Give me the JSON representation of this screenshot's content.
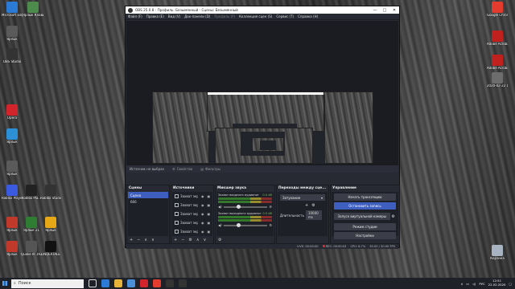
{
  "desktop_icons_left": [
    {
      "label": "Microsoft Edge",
      "color": "#2b7bd6"
    },
    {
      "label": "Ярлык Клавиатура",
      "color": "#4c8b4c"
    },
    {
      "label": "OBS Studio",
      "color": "#333333"
    },
    {
      "label": "Ярлык",
      "color": "#5a5a5a"
    },
    {
      "label": "Opera",
      "color": "#d1242b"
    },
    {
      "label": "Ярлык",
      "color": "#2d8fd5"
    },
    {
      "label": "Ярлык",
      "color": "#5a5a5a"
    },
    {
      "label": "Roblox Player",
      "color": "#3a5ae0"
    },
    {
      "label": "Roblox Pla...",
      "color": "#222222"
    },
    {
      "label": "Roblox Studio",
      "color": "#333333"
    },
    {
      "label": "Ярлык",
      "color": "#c0392b"
    },
    {
      "label": "Ярлык 21",
      "color": "#2e7d32"
    },
    {
      "label": "Ярлык",
      "color": "#e6a817"
    },
    {
      "label": "Ярлык",
      "color": "#c0392b"
    },
    {
      "label": "Quake III 1920x1080",
      "color": "#555555"
    },
    {
      "label": "UNDERTALE",
      "color": "#111111"
    }
  ],
  "desktop_icons_right": [
    {
      "label": "Google Chrome",
      "color": "#e33b2e"
    },
    {
      "label": "Adobe Acrobat Reader DC",
      "color": "#c0211f"
    },
    {
      "label": "Adobe Acrobat Reader DC",
      "color": "#c0211f"
    },
    {
      "label": "2020-02-22 14-36-07",
      "color": "#6d6d6d"
    },
    {
      "label": "Корзина",
      "color": "#a8b3c2"
    }
  ],
  "obs": {
    "title": "OBS 25.0.8 - Профиль: Безымянный - Сцены: Безымянный",
    "title_controls": [
      "—",
      "□",
      "✕"
    ],
    "menu": [
      {
        "label": "Файл (F)",
        "disabled": false
      },
      {
        "label": "Правка (E)",
        "disabled": false
      },
      {
        "label": "Вид (V)",
        "disabled": false
      },
      {
        "label": "Док-панели (D)",
        "disabled": false
      },
      {
        "label": "Профиль (P)",
        "disabled": true
      },
      {
        "label": "Коллекция сцен (S)",
        "disabled": false
      },
      {
        "label": "Сервис (T)",
        "disabled": false
      },
      {
        "label": "Справка (H)",
        "disabled": false
      }
    ],
    "preview_bar": {
      "source_status": "Источник не выбран",
      "properties_label": "Свойства",
      "filters_label": "Фильтры"
    },
    "scenes": {
      "title": "Сцены",
      "items": [
        "Сцена",
        "666"
      ],
      "active_index": 0,
      "footer": [
        "+",
        "−",
        "∧",
        "∨"
      ]
    },
    "sources": {
      "title": "Источники",
      "items": [
        "Захват экр",
        "Захват экр",
        "Захват экр",
        "Захват экр",
        "Захват экр"
      ],
      "footer": [
        "+",
        "−",
        "⚙",
        "∧",
        "∨"
      ]
    },
    "mixer": {
      "title": "Микшер звука",
      "tracks": [
        {
          "name": "Захват входного аудиопот",
          "db": "0.0 dB"
        },
        {
          "name": "Захват выходного аудиопот",
          "db": "0.0 dB"
        }
      ]
    },
    "transitions": {
      "title": "Переходы между сце...",
      "selected": "Затухание",
      "duration_label": "Длительность",
      "duration_value": "10000 ms"
    },
    "controls": {
      "title": "Управление",
      "buttons": [
        {
          "label": "Начать трансляцию",
          "primary": false
        },
        {
          "label": "Остановить запись",
          "primary": true
        },
        {
          "label": "Запуск виртуальной камеры",
          "primary": false
        },
        {
          "label": "Режим студии",
          "primary": false
        },
        {
          "label": "Настройки",
          "primary": false
        }
      ]
    },
    "statusbar": {
      "live": "LIVE: 00:00:00",
      "rec": "REC: 00:00:03",
      "cpu": "CPU: 6.7%",
      "fps": "30.00 / 30.00 FPS"
    }
  },
  "taskbar": {
    "search_placeholder": "Поиск",
    "apps": [
      {
        "name": "task-view-icon",
        "color": "#dddddd"
      },
      {
        "name": "edge-icon",
        "color": "#2b7bd6"
      },
      {
        "name": "explorer-icon",
        "color": "#e8b33a"
      },
      {
        "name": "store-icon",
        "color": "#4a90d9"
      },
      {
        "name": "opera-icon",
        "color": "#d1242b"
      },
      {
        "name": "chrome-icon",
        "color": "#e33b2e"
      },
      {
        "name": "roblox-icon",
        "color": "#333333"
      },
      {
        "name": "obs-icon",
        "color": "#333333"
      }
    ],
    "lang": "РУС",
    "time": "12:51",
    "date": "22.02.2020"
  }
}
